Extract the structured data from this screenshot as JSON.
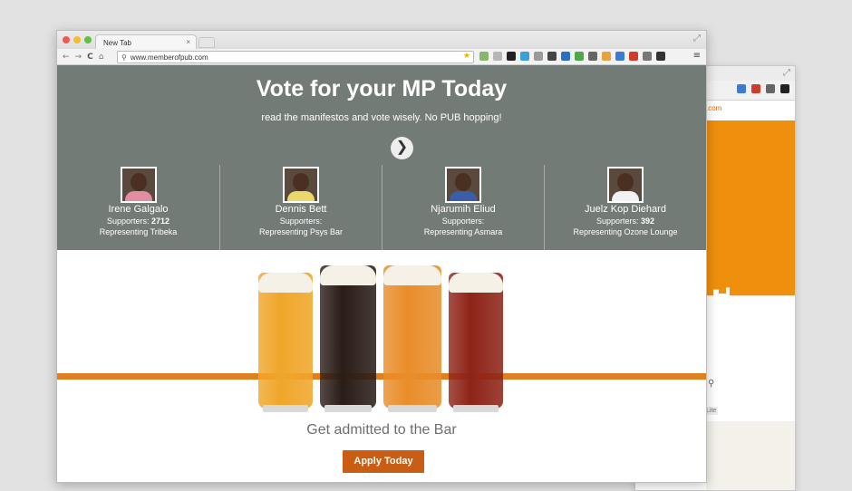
{
  "browser": {
    "tab_title": "New Tab",
    "tab_close": "×",
    "url": "www.memberofpub.com",
    "nav": {
      "back": "←",
      "forward": "→",
      "reload": "C",
      "home": "⌂"
    },
    "menu_glyph": "≡",
    "star_glyph": "★",
    "search_glyph": "⚲",
    "fullscreen_glyph": "⤢",
    "ext_icon_colors": [
      "#8ab66a",
      "#b7b7b7",
      "#222222",
      "#3aa0d8",
      "#9a9a9a",
      "#444444",
      "#2a6fc7",
      "#4fa84a",
      "#666666",
      "#e6a23c",
      "#3b7bd6",
      "#d23b2b",
      "#777777",
      "#333333"
    ]
  },
  "background_window": {
    "orange_label": ".com",
    "lite_badge": "Lite",
    "search_glyph": "⚲",
    "toolbar_icon_colors": [
      "#3b7bd6",
      "#d23b2b",
      "#666666",
      "#222222"
    ]
  },
  "hero": {
    "title": "Vote for your MP Today",
    "subtitle": "read the manifestos and vote wisely. No PUB hopping!",
    "next_arrow": "❯"
  },
  "candidates": [
    {
      "name": "Irene Galgalo",
      "supporters_label": "Supporters:",
      "supporters_count": "2712",
      "representing": "Representing Tribeka",
      "shirt_color": "#e08ea0"
    },
    {
      "name": "Dennis Bett",
      "supporters_label": "Supporters:",
      "supporters_count": "",
      "representing": "Representing Psys Bar",
      "shirt_color": "#e8d96a"
    },
    {
      "name": "Njarumih Eliud",
      "supporters_label": "Supporters:",
      "supporters_count": "",
      "representing": "Representing Asmara",
      "shirt_color": "#3a5fa8"
    },
    {
      "name": "Juelz Kop Diehard",
      "supporters_label": "Supporters:",
      "supporters_count": "392",
      "representing": "Representing Ozone Lounge",
      "shirt_color": "#f2f2f2"
    }
  ],
  "colors": {
    "hero_bg": "#737b77",
    "accent_orange": "#df7f1f",
    "button_orange": "#c95d14"
  },
  "beers": [
    {
      "name": "lager",
      "color": "#f0a62a"
    },
    {
      "name": "stout",
      "color": "#2a1d18"
    },
    {
      "name": "pale-ale",
      "color": "#e98d2a"
    },
    {
      "name": "red-ale",
      "color": "#8e2418"
    }
  ],
  "cta": {
    "text": "Get admitted to the Bar",
    "button": "Apply Today"
  }
}
